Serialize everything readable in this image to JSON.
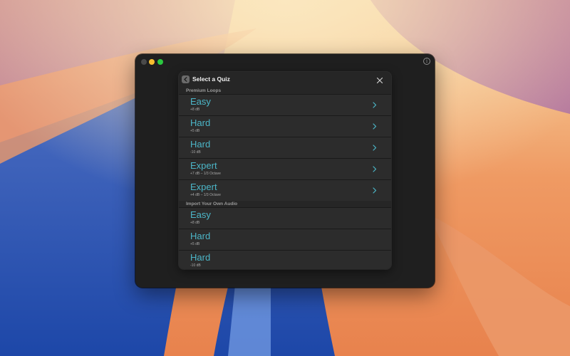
{
  "sheet": {
    "title": "Select a Quiz"
  },
  "sections": [
    {
      "header": "Premium Loops",
      "items": [
        {
          "title": "Easy",
          "subtitle": "+8 dB"
        },
        {
          "title": "Hard",
          "subtitle": "+5 dB"
        },
        {
          "title": "Hard",
          "subtitle": "-10 dB"
        },
        {
          "title": "Expert",
          "subtitle": "+7 dB – 1/3 Octave"
        },
        {
          "title": "Expert",
          "subtitle": "+4 dB – 1/3 Octave"
        }
      ]
    },
    {
      "header": "Import Your Own Audio",
      "items": [
        {
          "title": "Easy",
          "subtitle": "+8 dB"
        },
        {
          "title": "Hard",
          "subtitle": "+5 dB"
        },
        {
          "title": "Hard",
          "subtitle": "-10 dB"
        }
      ]
    }
  ],
  "colors": {
    "accent_text": "#4cb6c8",
    "window_bg": "#1f1f1f",
    "sheet_bg": "#262626",
    "row_bg": "#2c2c2c"
  },
  "icons": {
    "back": "chevron-left-icon",
    "close": "close-icon",
    "row": "chevron-right-icon",
    "info": "info-icon"
  }
}
